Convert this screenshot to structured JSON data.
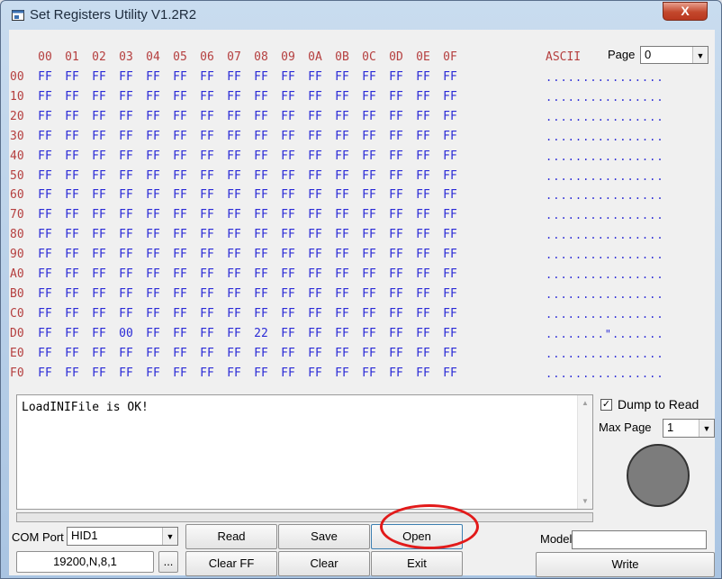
{
  "window": {
    "title": "Set Registers Utility V1.2R2",
    "close_glyph": "X"
  },
  "hex": {
    "columns": [
      "00",
      "01",
      "02",
      "03",
      "04",
      "05",
      "06",
      "07",
      "08",
      "09",
      "0A",
      "0B",
      "0C",
      "0D",
      "0E",
      "0F"
    ],
    "ascii_header": "ASCII",
    "rows": [
      {
        "addr": "00",
        "cells": [
          "FF",
          "FF",
          "FF",
          "FF",
          "FF",
          "FF",
          "FF",
          "FF",
          "FF",
          "FF",
          "FF",
          "FF",
          "FF",
          "FF",
          "FF",
          "FF"
        ],
        "ascii": "................"
      },
      {
        "addr": "10",
        "cells": [
          "FF",
          "FF",
          "FF",
          "FF",
          "FF",
          "FF",
          "FF",
          "FF",
          "FF",
          "FF",
          "FF",
          "FF",
          "FF",
          "FF",
          "FF",
          "FF"
        ],
        "ascii": "................"
      },
      {
        "addr": "20",
        "cells": [
          "FF",
          "FF",
          "FF",
          "FF",
          "FF",
          "FF",
          "FF",
          "FF",
          "FF",
          "FF",
          "FF",
          "FF",
          "FF",
          "FF",
          "FF",
          "FF"
        ],
        "ascii": "................"
      },
      {
        "addr": "30",
        "cells": [
          "FF",
          "FF",
          "FF",
          "FF",
          "FF",
          "FF",
          "FF",
          "FF",
          "FF",
          "FF",
          "FF",
          "FF",
          "FF",
          "FF",
          "FF",
          "FF"
        ],
        "ascii": "................"
      },
      {
        "addr": "40",
        "cells": [
          "FF",
          "FF",
          "FF",
          "FF",
          "FF",
          "FF",
          "FF",
          "FF",
          "FF",
          "FF",
          "FF",
          "FF",
          "FF",
          "FF",
          "FF",
          "FF"
        ],
        "ascii": "................"
      },
      {
        "addr": "50",
        "cells": [
          "FF",
          "FF",
          "FF",
          "FF",
          "FF",
          "FF",
          "FF",
          "FF",
          "FF",
          "FF",
          "FF",
          "FF",
          "FF",
          "FF",
          "FF",
          "FF"
        ],
        "ascii": "................"
      },
      {
        "addr": "60",
        "cells": [
          "FF",
          "FF",
          "FF",
          "FF",
          "FF",
          "FF",
          "FF",
          "FF",
          "FF",
          "FF",
          "FF",
          "FF",
          "FF",
          "FF",
          "FF",
          "FF"
        ],
        "ascii": "................"
      },
      {
        "addr": "70",
        "cells": [
          "FF",
          "FF",
          "FF",
          "FF",
          "FF",
          "FF",
          "FF",
          "FF",
          "FF",
          "FF",
          "FF",
          "FF",
          "FF",
          "FF",
          "FF",
          "FF"
        ],
        "ascii": "................"
      },
      {
        "addr": "80",
        "cells": [
          "FF",
          "FF",
          "FF",
          "FF",
          "FF",
          "FF",
          "FF",
          "FF",
          "FF",
          "FF",
          "FF",
          "FF",
          "FF",
          "FF",
          "FF",
          "FF"
        ],
        "ascii": "................"
      },
      {
        "addr": "90",
        "cells": [
          "FF",
          "FF",
          "FF",
          "FF",
          "FF",
          "FF",
          "FF",
          "FF",
          "FF",
          "FF",
          "FF",
          "FF",
          "FF",
          "FF",
          "FF",
          "FF"
        ],
        "ascii": "................"
      },
      {
        "addr": "A0",
        "cells": [
          "FF",
          "FF",
          "FF",
          "FF",
          "FF",
          "FF",
          "FF",
          "FF",
          "FF",
          "FF",
          "FF",
          "FF",
          "FF",
          "FF",
          "FF",
          "FF"
        ],
        "ascii": "................"
      },
      {
        "addr": "B0",
        "cells": [
          "FF",
          "FF",
          "FF",
          "FF",
          "FF",
          "FF",
          "FF",
          "FF",
          "FF",
          "FF",
          "FF",
          "FF",
          "FF",
          "FF",
          "FF",
          "FF"
        ],
        "ascii": "................"
      },
      {
        "addr": "C0",
        "cells": [
          "FF",
          "FF",
          "FF",
          "FF",
          "FF",
          "FF",
          "FF",
          "FF",
          "FF",
          "FF",
          "FF",
          "FF",
          "FF",
          "FF",
          "FF",
          "FF"
        ],
        "ascii": "................"
      },
      {
        "addr": "D0",
        "cells": [
          "FF",
          "FF",
          "FF",
          "00",
          "FF",
          "FF",
          "FF",
          "FF",
          "22",
          "FF",
          "FF",
          "FF",
          "FF",
          "FF",
          "FF",
          "FF"
        ],
        "ascii": "........\"......."
      },
      {
        "addr": "E0",
        "cells": [
          "FF",
          "FF",
          "FF",
          "FF",
          "FF",
          "FF",
          "FF",
          "FF",
          "FF",
          "FF",
          "FF",
          "FF",
          "FF",
          "FF",
          "FF",
          "FF"
        ],
        "ascii": "................"
      },
      {
        "addr": "F0",
        "cells": [
          "FF",
          "FF",
          "FF",
          "FF",
          "FF",
          "FF",
          "FF",
          "FF",
          "FF",
          "FF",
          "FF",
          "FF",
          "FF",
          "FF",
          "FF",
          "FF"
        ],
        "ascii": "................"
      }
    ]
  },
  "page": {
    "label": "Page",
    "value": "0"
  },
  "log": {
    "text": "LoadINIFile is OK!"
  },
  "progress": {
    "fraction": 0
  },
  "options": {
    "dump_label": "Dump to Read",
    "dump_checked": "✓",
    "max_page_label": "Max Page",
    "max_page_value": "1"
  },
  "port": {
    "label": "COM Port",
    "value": "HID1",
    "settings": "19200,N,8,1",
    "browse": "..."
  },
  "buttons": {
    "read": "Read",
    "save": "Save",
    "open": "Open",
    "clear_ff": "Clear FF",
    "clear": "Clear",
    "exit": "Exit",
    "write": "Write"
  },
  "model": {
    "label": "Model",
    "value": ""
  },
  "colors": {
    "address": "#b53f3f",
    "byte": "#2b2bd6",
    "annotation": "#e21a1a",
    "status_led": "#7c7c7c"
  }
}
